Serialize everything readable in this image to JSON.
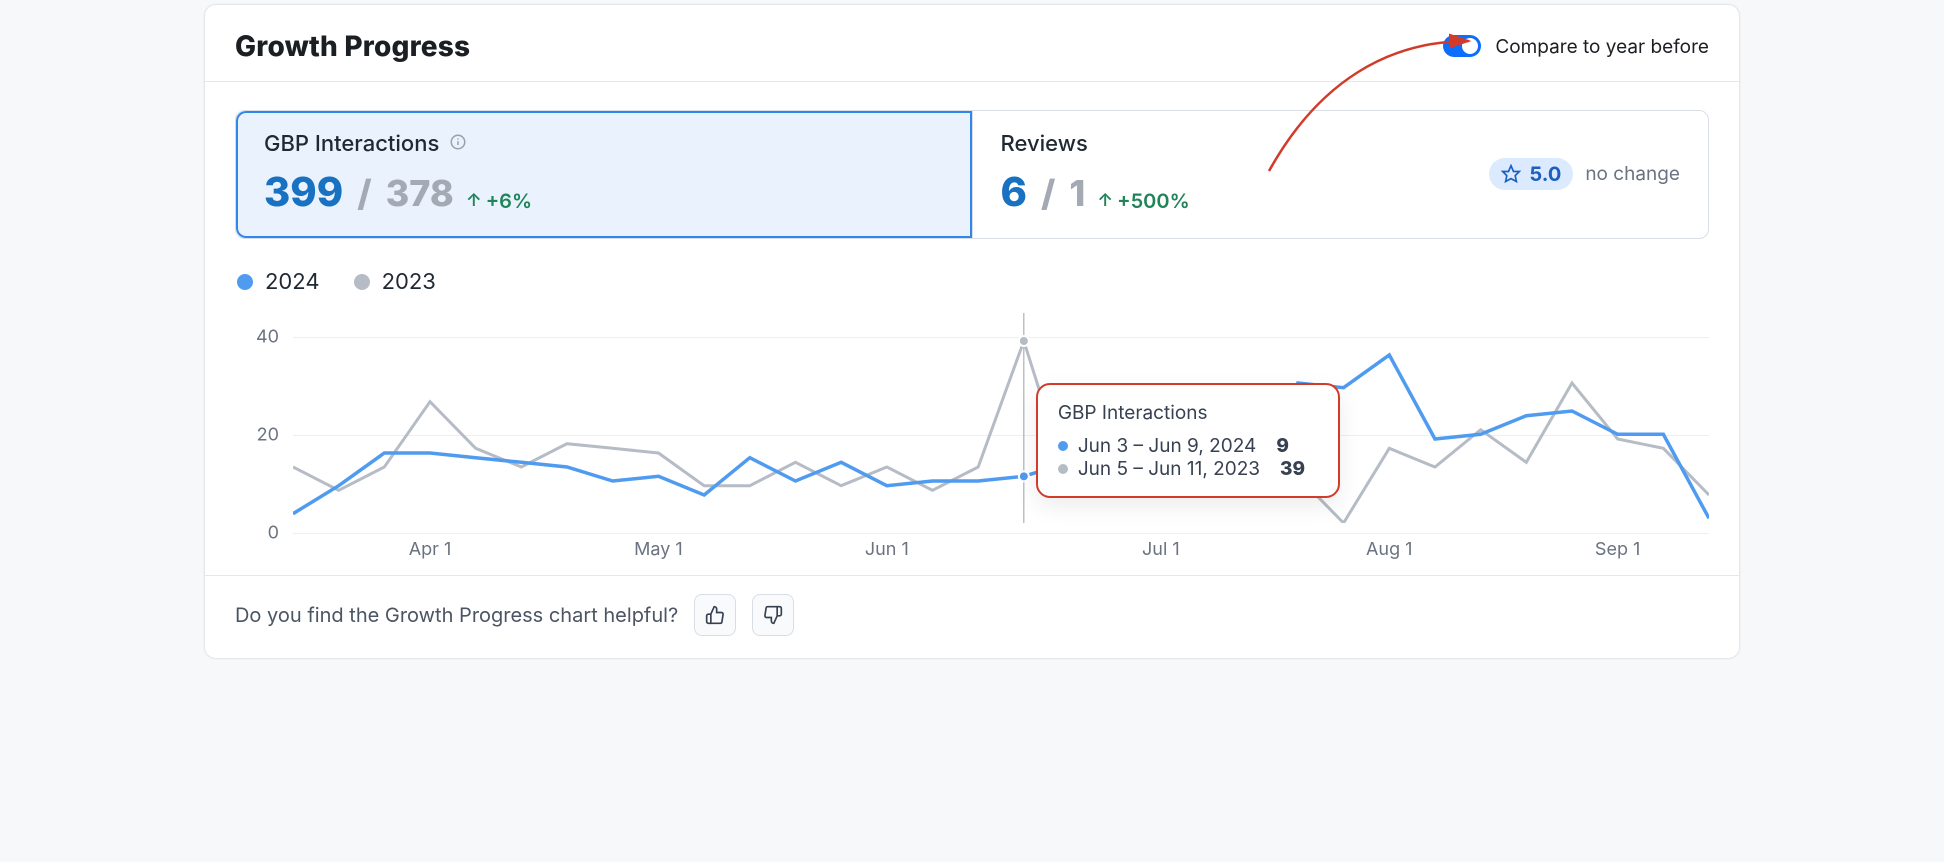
{
  "header": {
    "title": "Growth Progress",
    "compare_label": "Compare to year before",
    "compare_on": true
  },
  "colors": {
    "series_current": "#4f9bf0",
    "series_prev": "#b6bcc5",
    "accent_green": "#218358",
    "selected_bg": "#e9f2fd"
  },
  "tabs": {
    "gbp": {
      "label": "GBP Interactions",
      "value_current": "399",
      "value_prev": "378",
      "delta": "+6%",
      "delta_dir": "up",
      "selected": true
    },
    "reviews": {
      "label": "Reviews",
      "value_current": "6",
      "value_prev": "1",
      "delta": "+500%",
      "delta_dir": "up",
      "score": "5.0",
      "score_change": "no change"
    }
  },
  "legend": {
    "current": "2024",
    "prev": "2023"
  },
  "chart_data": {
    "type": "line",
    "title": "GBP Interactions",
    "xlabel": "",
    "ylabel": "",
    "ylim": [
      0,
      45
    ],
    "y_ticks": [
      0,
      20,
      40
    ],
    "categories": [
      "Apr 1",
      "May 1",
      "Jun 1",
      "Jul 1",
      "Aug 1",
      "Sep 1"
    ],
    "series": [
      {
        "name": "2024",
        "color": "#4f9bf0",
        "values": [
          2,
          8,
          15,
          15,
          14,
          13,
          12,
          9,
          10,
          6,
          14,
          9,
          13,
          8,
          9,
          9,
          10,
          13,
          20,
          22,
          17,
          9,
          30,
          29,
          36,
          18,
          19,
          23,
          24,
          19,
          19,
          1
        ]
      },
      {
        "name": "2023",
        "color": "#b6bcc5",
        "values": [
          12,
          7,
          12,
          26,
          16,
          12,
          17,
          16,
          15,
          8,
          8,
          13,
          8,
          12,
          7,
          12,
          39,
          8,
          26,
          13,
          10,
          12,
          10,
          0,
          16,
          12,
          20,
          13,
          30,
          18,
          16,
          6
        ]
      }
    ],
    "hover_index": 16
  },
  "tooltip": {
    "title": "GBP Interactions",
    "rows": [
      {
        "color": "#4f9bf0",
        "label": "Jun 3 – Jun 9, 2024",
        "value": "9"
      },
      {
        "color": "#b6bcc5",
        "label": "Jun 5 – Jun 11, 2023",
        "value": "39"
      }
    ]
  },
  "feedback": {
    "question": "Do you find the Growth Progress chart helpful?"
  }
}
